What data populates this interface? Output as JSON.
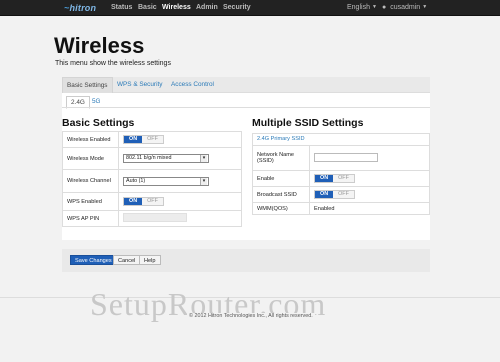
{
  "header": {
    "logo": "hitron",
    "nav": [
      "Status",
      "Basic",
      "Wireless",
      "Admin",
      "Security"
    ],
    "active_nav": "Wireless",
    "language": "English",
    "user": "cusadmin"
  },
  "page": {
    "title": "Wireless",
    "subtitle": "This menu show the wireless settings"
  },
  "tabs": [
    "Basic Settings",
    "WPS & Security",
    "Access Control"
  ],
  "band_tabs": [
    "2.4G",
    "5G"
  ],
  "basic_settings": {
    "heading": "Basic Settings",
    "rows": {
      "wireless_enabled": {
        "label": "Wireless Enabled",
        "on": "ON",
        "off": "OFF"
      },
      "wireless_mode": {
        "label": "Wireless Mode",
        "value": "802.11 b/g/n mixed"
      },
      "wireless_channel": {
        "label": "Wireless Channel",
        "value": "Auto (1)"
      },
      "wps_enabled": {
        "label": "WPS Enabled",
        "on": "ON",
        "off": "OFF"
      },
      "wps_ap_pin": {
        "label": "WPS AP PIN",
        "value": ""
      }
    }
  },
  "multiple_ssid": {
    "heading": "Multiple SSID Settings",
    "link": "2.4G Primary SSID",
    "rows": {
      "network_name": {
        "label": "Network Name (SSID)",
        "value": ""
      },
      "enable": {
        "label": "Enable",
        "on": "ON",
        "off": "OFF"
      },
      "broadcast_ssid": {
        "label": "Broadcast SSID",
        "on": "ON",
        "off": "OFF"
      },
      "wmm": {
        "label": "WMM(QOS)",
        "value": "Enabled"
      }
    }
  },
  "buttons": {
    "save": "Save Changes",
    "cancel": "Cancel",
    "help": "Help"
  },
  "watermark": "SetupRouter.com",
  "footer": "© 2012 Hitron Technologies Inc.,  All rights reserved.",
  "colors": {
    "topbar": "#222222",
    "accent": "#1f5fb7",
    "link": "#2a7ab8"
  }
}
